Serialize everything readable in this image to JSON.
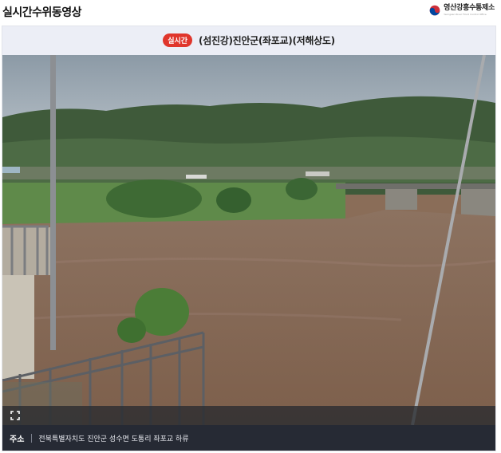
{
  "header": {
    "title": "실시간수위동영상",
    "org_name": "영산강홍수통제소",
    "org_subtitle": "Yeongsan River Flood Control Office"
  },
  "player": {
    "live_badge": "실시간",
    "station_title": "(섬진강)진안군(좌포교)(저해상도)"
  },
  "address": {
    "label": "주소",
    "value": "전북특별자치도 진안군 성수면 도통리 좌포교 하류"
  },
  "colors": {
    "badge": "#e0362c",
    "title_bar": "#eceef6",
    "address_bar": "#262a34",
    "river": "#8a6d58"
  },
  "icons": {
    "fullscreen": "fullscreen-icon",
    "emblem": "taegeuk-emblem-icon"
  }
}
